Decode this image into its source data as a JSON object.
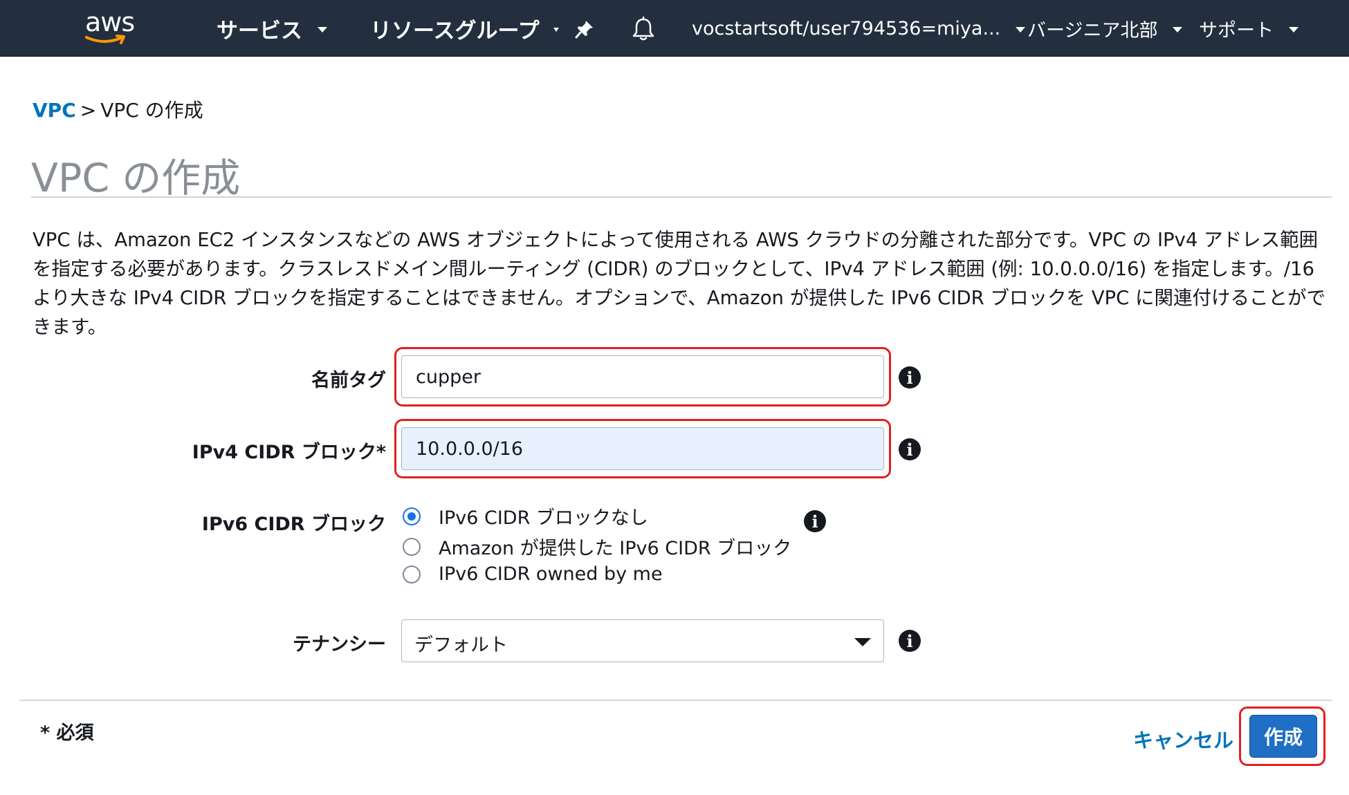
{
  "nav": {
    "logo_text": "aws",
    "services": "サービス",
    "resource_groups": "リソースグループ",
    "account": "vocstartsoft/user794536=miya...",
    "region": "バージニア北部",
    "support": "サポート",
    "colors": {
      "background": "#232f3e",
      "logo_smile": "#ff9900"
    }
  },
  "breadcrumb": {
    "root": "VPC",
    "separator": ">",
    "current": "VPC の作成"
  },
  "page": {
    "title": "VPC の作成",
    "description": "VPC は、Amazon EC2 インスタンスなどの AWS オブジェクトによって使用される AWS クラウドの分離された部分です。VPC の IPv4 アドレス範囲を指定する必要があります。クラスレスドメイン間ルーティング (CIDR) のブロックとして、IPv4 アドレス範囲 (例: 10.0.0.0/16) を指定します。/16 より大きな IPv4 CIDR ブロックを指定することはできません。オプションで、Amazon が提供した IPv6 CIDR ブロックを VPC に関連付けることができます。"
  },
  "form": {
    "name_tag": {
      "label": "名前タグ",
      "value": "cupper"
    },
    "ipv4_cidr": {
      "label": "IPv4 CIDR ブロック*",
      "value": "10.0.0.0/16"
    },
    "ipv6_cidr": {
      "label": "IPv6 CIDR ブロック",
      "options": [
        {
          "label": "IPv6 CIDR ブロックなし",
          "selected": true
        },
        {
          "label": "Amazon が提供した IPv6 CIDR ブロック",
          "selected": false
        },
        {
          "label": "IPv6 CIDR owned by me",
          "selected": false
        }
      ]
    },
    "tenancy": {
      "label": "テナンシー",
      "value": "デフォルト"
    }
  },
  "footer": {
    "required_note": "* 必須",
    "cancel": "キャンセル",
    "create": "作成"
  },
  "colors": {
    "link": "#0073bb",
    "primary_button": "#1f6fc5",
    "highlight": "#e0201f",
    "radio_selected": "#1a73e8"
  }
}
